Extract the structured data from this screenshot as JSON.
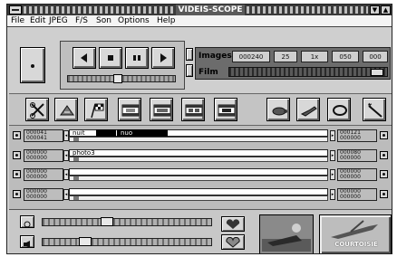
{
  "window": {
    "title": "VIDEIS-SCOPE"
  },
  "menu": [
    "File",
    "Edit",
    "JPEG",
    "F/S",
    "Son",
    "Options",
    "Help"
  ],
  "info": {
    "images_label": "Images",
    "film_label": "Film",
    "counter": "000240",
    "fps": "25",
    "mode": "1x",
    "value_a": "050",
    "value_b": "000"
  },
  "tracks": [
    {
      "left_code": "000041\n000041",
      "right_code": "000121\n000000",
      "text": "nuit",
      "highlight": "nuo"
    },
    {
      "left_code": "000000\n000000",
      "right_code": "000080\n000000",
      "text": "photo3",
      "highlight": ""
    },
    {
      "left_code": "000000\n000000",
      "right_code": "000000\n000000",
      "text": "",
      "highlight": ""
    },
    {
      "left_code": "000000\n000000",
      "right_code": "000000\n000000",
      "text": "",
      "highlight": ""
    }
  ],
  "preview": {
    "logo_text": "COURTOISIE"
  },
  "icons": {
    "transport": [
      "rewind-icon",
      "stop-icon",
      "pause-icon",
      "play-icon"
    ],
    "toolbar": [
      "scissors-icon",
      "glue-icon",
      "checker-flag-icon",
      "film-clip-1-icon",
      "film-clip-2-icon",
      "film-clip-3-icon",
      "film-clip-4-icon",
      "turtle-icon",
      "hare-icon",
      "loop-icon",
      "magic-wand-icon"
    ]
  }
}
